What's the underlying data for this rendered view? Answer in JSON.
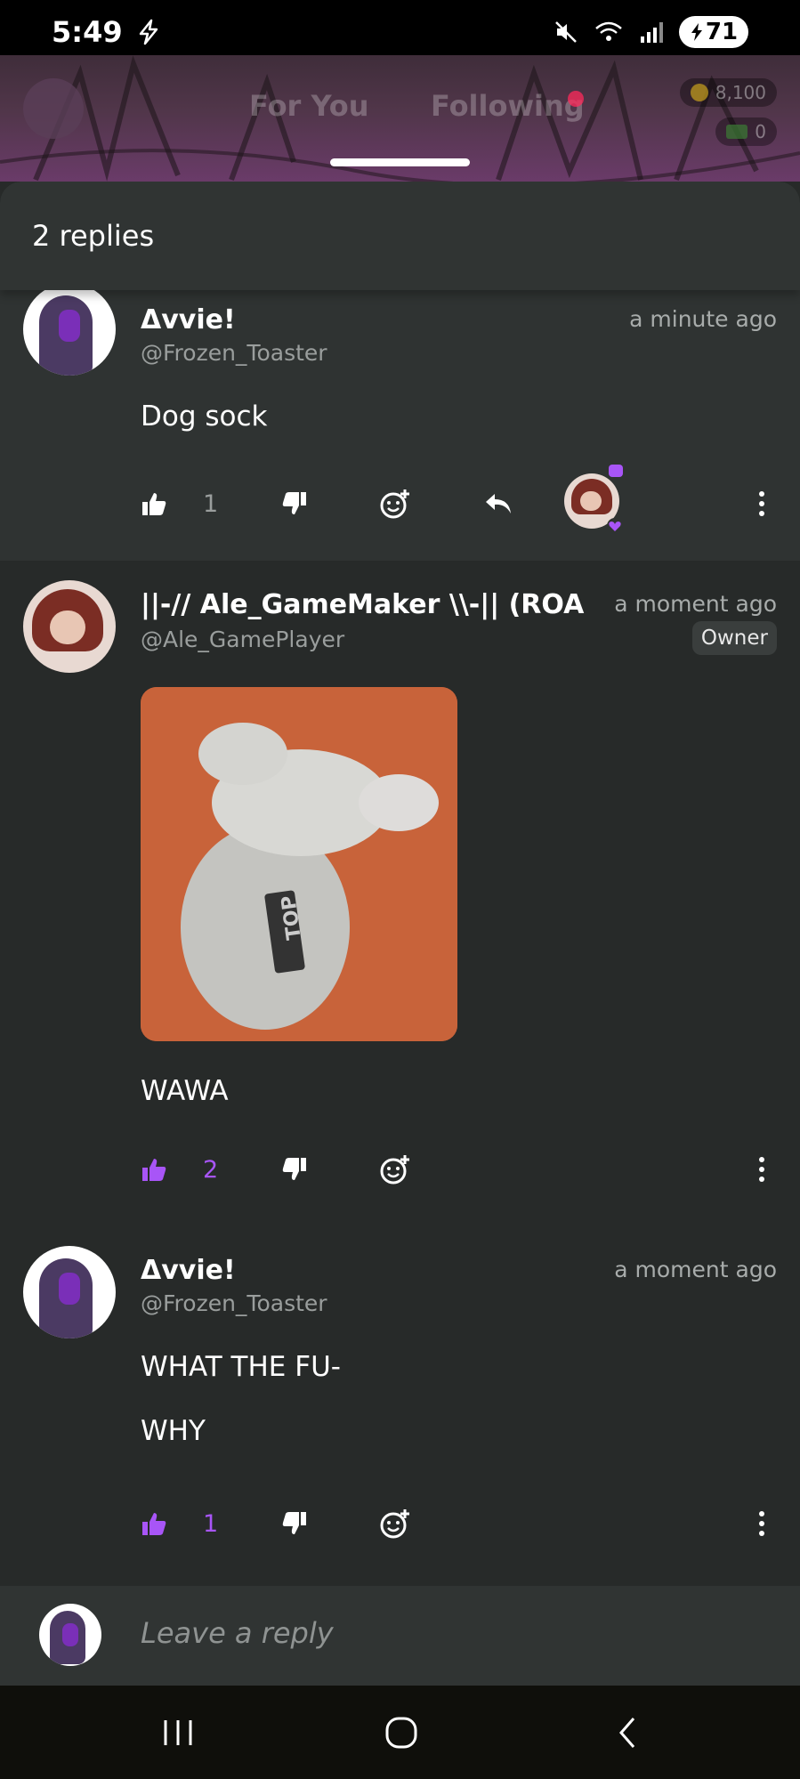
{
  "status_bar": {
    "time": "5:49",
    "battery": "71"
  },
  "background_header": {
    "tabs": [
      {
        "label": "For You"
      },
      {
        "label": "Following"
      }
    ],
    "coins": "8,100",
    "cash": "0"
  },
  "sheet": {
    "replies_count": "2 replies"
  },
  "comments": [
    {
      "name": "Δvvie!",
      "handle": "@Frozen_Toaster",
      "time": "a minute ago",
      "text": "Dog sock",
      "likes": "1"
    },
    {
      "name": "||-// Ale_GameMaker \\\\-|| (ROAD",
      "handle": "@Ale_GamePlayer",
      "time": "a moment ago",
      "badge": "Owner",
      "text": "WAWA",
      "likes": "2"
    },
    {
      "name": "Δvvie!",
      "handle": "@Frozen_Toaster",
      "time": "a moment ago",
      "text_lines": [
        "WHAT THE FU-",
        "WHY"
      ],
      "likes": "1"
    }
  ],
  "reply_bar": {
    "placeholder": "Leave a reply"
  },
  "colors": {
    "accent": "#a855f7",
    "background": "#272a29",
    "panel": "#303433"
  }
}
